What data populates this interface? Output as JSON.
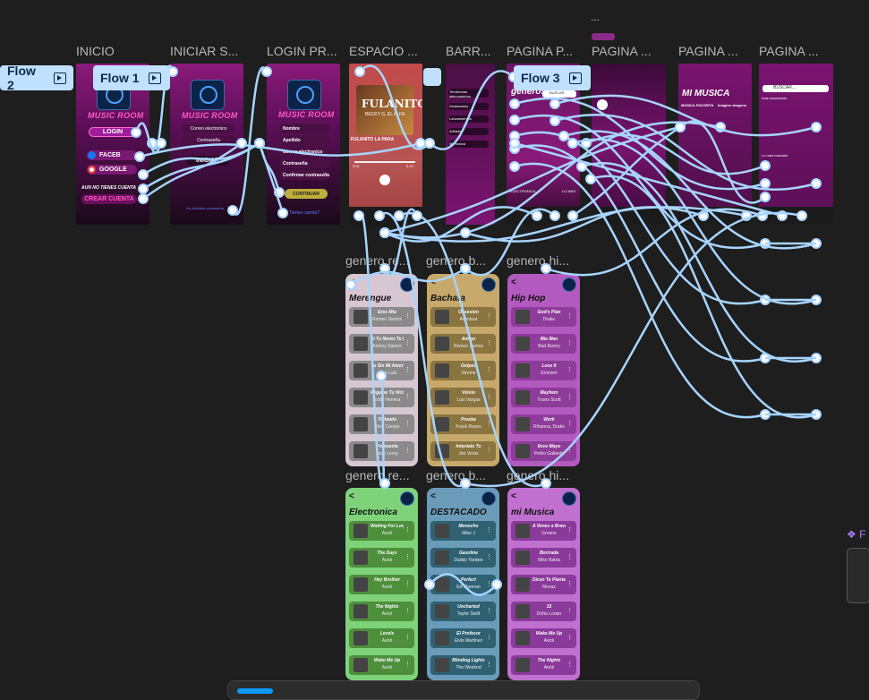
{
  "canvas": {
    "ellipsis": "...",
    "side_label": "❖ F"
  },
  "frames": {
    "inicio": {
      "title": "INICIO",
      "brand": "MUSIC ROOM",
      "login": "LOGIN",
      "facebook": "FACEB",
      "google": "GOOGLE",
      "no_account": "AUN NO TIENES CUENTA",
      "create": "CREAR CUENTA"
    },
    "iniciar": {
      "title": "INICIAR S...",
      "brand": "MUSIC ROOM",
      "field1": "Correo electronico",
      "field2": "Contraseña",
      "btn": "INICIAR",
      "link": "Ha olvidado contraseña"
    },
    "login_pr": {
      "title": "LOGIN PR...",
      "brand": "MUSIC ROOM",
      "f1": "Nombre",
      "f2": "Apellido",
      "f3": "Correo electronico",
      "f4": "Contraseña",
      "f5": "Confirmar contraseña",
      "btn": "CONTINUAR",
      "link": "¿Tienes cuenta?"
    },
    "espacio": {
      "title": "ESPACIO ...",
      "album": "FULANITO",
      "album_sub": "BECKY G, EL ALFA",
      "song": "FULANITO LA PARA",
      "t_start": "0:01",
      "t_end": "3:13"
    },
    "barra": {
      "title": "BARR...",
      "items": [
        "Tendencias latinoamerica",
        "Destacados",
        "Lanzamientos",
        "Artistas",
        "Mi musica"
      ]
    },
    "pagina_p": {
      "title": "PAGINA P...",
      "header": "generos",
      "search": "BUSCAR",
      "labels": [
        "MERENGUE",
        "BACHATA",
        "POP",
        "ELECTRONICA",
        "LO MAS"
      ]
    },
    "pagina_2": {
      "title": "PAGINA ..."
    },
    "pagina_3": {
      "title": "PAGINA ...",
      "header": "MI MUSICA",
      "sub1": "MUSICA FAVORITA",
      "sub2": "Imagine dragons"
    },
    "pagina_4": {
      "title": "PAGINA ...",
      "search": "BUSCAR...",
      "sub": "mas escuchado",
      "sub2": "Lo mas buscado"
    }
  },
  "flows": [
    {
      "label": "Flow 2"
    },
    {
      "label": "Flow 1"
    },
    {
      "label": "Flow 3"
    }
  ],
  "genres": [
    {
      "frame_title": "genero.re...",
      "title": "Merengue",
      "color": "#d7c7d2",
      "row": "#8a8a8a",
      "songs": [
        {
          "t": "Eres Mia",
          "a": "Romeo Santos"
        },
        {
          "t": "Si Tu Novio Te Deja",
          "a": "Antony Santos"
        },
        {
          "t": "Tu Sin Mi Amor",
          "a": "Juan Luis"
        },
        {
          "t": "Pegame Tu Vicio",
          "a": "Eddy Herrera"
        },
        {
          "t": "Tiritando",
          "a": "Elvis Crespo"
        },
        {
          "t": "Propuesta",
          "a": "Jose Leroy"
        }
      ]
    },
    {
      "frame_title": "genero.b...",
      "title": "Bachata",
      "color": "#c7a96b",
      "row": "#8a7440",
      "songs": [
        {
          "t": "Obsesion",
          "a": "Aventura"
        },
        {
          "t": "Amigo",
          "a": "Romeo Santos"
        },
        {
          "t": "Golpes",
          "a": "Xtreme"
        },
        {
          "t": "Volvio",
          "a": "Luis Vargas"
        },
        {
          "t": "Prueba",
          "a": "Frank Reyes"
        },
        {
          "t": "Intentalo Tu",
          "a": "Joe Veras"
        }
      ]
    },
    {
      "frame_title": "genero.hi...",
      "title": "Hip Hop",
      "color": "#b35ac0",
      "row": "#8e3c99",
      "songs": [
        {
          "t": "God's Plan",
          "a": "Drake"
        },
        {
          "t": "Mia Man",
          "a": "Bad Bunny"
        },
        {
          "t": "Lose It",
          "a": "Eminem"
        },
        {
          "t": "Mayhem",
          "a": "Travis Scott"
        },
        {
          "t": "Work",
          "a": "Rihanna, Drake"
        },
        {
          "t": "Ilove Mayo",
          "a": "Pedro Gallardo"
        }
      ]
    },
    {
      "frame_title": "genero.re...",
      "title": "Electronica",
      "color": "#7ed37a",
      "row": "#4e8f3c",
      "songs": [
        {
          "t": "Waiting For Love",
          "a": "Avicii"
        },
        {
          "t": "The Days",
          "a": "Avicii"
        },
        {
          "t": "Hey Brother",
          "a": "Avicii"
        },
        {
          "t": "The Nights",
          "a": "Avicii"
        },
        {
          "t": "Levels",
          "a": "Avicii"
        },
        {
          "t": "Wake Me Up",
          "a": "Avicii"
        }
      ]
    },
    {
      "frame_title": "genero.b...",
      "title": "DESTACADO",
      "color": "#6a9bb8",
      "row": "#2f6172",
      "songs": [
        {
          "t": "Monocho",
          "a": "Mike J"
        },
        {
          "t": "Gasoline",
          "a": "Daddy Yankee"
        },
        {
          "t": "Perfect",
          "a": "Ed Sheeran"
        },
        {
          "t": "Uncharted",
          "a": "Taylor Swift"
        },
        {
          "t": "El Profesor",
          "a": "Elvis Martinez"
        },
        {
          "t": "Blinding Lights",
          "a": "The Weeknd"
        }
      ]
    },
    {
      "frame_title": "genero.hi...",
      "title": "mi Musica",
      "color": "#c070cf",
      "row": "#8a3a9a",
      "songs": [
        {
          "t": "A Venes a Bravo",
          "a": "Grnone"
        },
        {
          "t": "Borrrada",
          "a": "Mike Bahia"
        },
        {
          "t": "Dicen Te Plantes",
          "a": "Mesaz"
        },
        {
          "t": "15",
          "a": "Doña Lorain"
        },
        {
          "t": "Wake Me Up",
          "a": "Avicii"
        },
        {
          "t": "The Nights",
          "a": "Avicii"
        }
      ]
    }
  ],
  "colors": {
    "bg": "#1e1e1e",
    "wire": "#a8d4ff",
    "flow": "#bfe0ff"
  }
}
